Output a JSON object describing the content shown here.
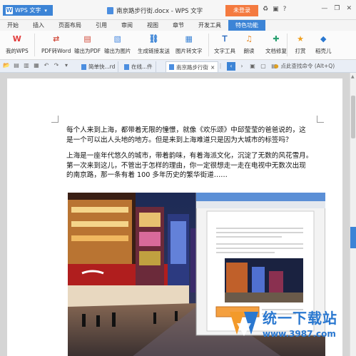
{
  "titlebar": {
    "app_label": "WPS 文字",
    "doc_title": "南京路步行街.docx - WPS 文字",
    "login_label": "未登录"
  },
  "tabs": [
    "开始",
    "插入",
    "页面布局",
    "引用",
    "审阅",
    "视图",
    "章节",
    "开发工具",
    "特色功能"
  ],
  "active_tab": "特色功能",
  "ribbon": {
    "buttons": [
      {
        "label": "我的WPS",
        "icon": "wps-logo-icon"
      },
      {
        "label": "PDF转Word",
        "icon": "pdf-to-word-icon"
      },
      {
        "label": "输出为PDF",
        "icon": "export-pdf-icon"
      },
      {
        "label": "输出为图片",
        "icon": "export-image-icon"
      },
      {
        "label": "生成链接发送",
        "icon": "share-link-icon"
      },
      {
        "label": "图片转文字",
        "icon": "image-to-text-icon"
      },
      {
        "label": "文字工具",
        "icon": "text-tool-icon"
      },
      {
        "label": "朗读",
        "icon": "read-aloud-icon"
      },
      {
        "label": "文档修复",
        "icon": "doc-repair-icon"
      },
      {
        "label": "打赏",
        "icon": "reward-icon"
      },
      {
        "label": "稻壳儿",
        "icon": "docer-icon"
      }
    ]
  },
  "doc_tabs": [
    {
      "label": "简单快...rd"
    },
    {
      "label": "在线...件"
    },
    {
      "label": "南京路步行街"
    }
  ],
  "command_search": "点此查找命令 (Alt+Q)",
  "document": {
    "para1_line1": "每个人来到上海，都带着无限的憧憬，就像《欢乐颂》中邱莹莹的爸爸说的，这",
    "para1_line2": "是一个可以出人头地的地方。但是来到上海难道只是因为大城市的标签吗？",
    "para2_line1": "上海是一座年代悠久的城市，带着韵味，有着海派文化，沉淀了无数的风花雪月。",
    "para2_line2": "第一次来到这儿，不管出于怎样的理由，你一定很想走一走在电视中无数次出现",
    "para2_line3": "的南京路，那一条有着 100 多年历史的繁华街道……"
  },
  "watermark": {
    "name": "统一下载站",
    "url": "www.3987.com"
  },
  "colors": {
    "accent": "#3c84d6",
    "login": "#f47a3f"
  }
}
